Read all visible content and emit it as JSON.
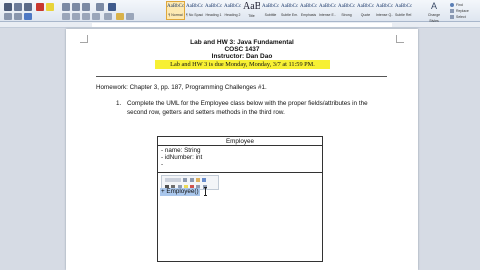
{
  "ribbon": {
    "styles": [
      {
        "sample": "AaBbCcDc",
        "name": "¶ Normal",
        "selected": true
      },
      {
        "sample": "AaBbCcDc",
        "name": "¶ No Spaci...",
        "selected": false
      },
      {
        "sample": "AaBbCc",
        "name": "Heading 1",
        "selected": false
      },
      {
        "sample": "AaBbCc",
        "name": "Heading 2",
        "selected": false
      },
      {
        "sample": "AaB",
        "name": "Title",
        "selected": false
      },
      {
        "sample": "AaBbCc.",
        "name": "Subtitle",
        "selected": false
      },
      {
        "sample": "AaBbCcDc",
        "name": "Subtle Em...",
        "selected": false
      },
      {
        "sample": "AaBbCcDc",
        "name": "Emphasis",
        "selected": false
      },
      {
        "sample": "AaBbCcDc",
        "name": "Intense E...",
        "selected": false
      },
      {
        "sample": "AaBbCcDc",
        "name": "Strong",
        "selected": false
      },
      {
        "sample": "AaBbCcDc",
        "name": "Quote",
        "selected": false
      },
      {
        "sample": "AaBbCcDc",
        "name": "Intense Q...",
        "selected": false
      },
      {
        "sample": "AaBbCcDc",
        "name": "Subtle Ref...",
        "selected": false
      }
    ],
    "change_styles": "Change Styles",
    "editing": [
      "Find",
      "Replace",
      "Select"
    ]
  },
  "document": {
    "title_lines": [
      "Lab and HW 3: Java Fundamental",
      "COSC 1437",
      "Instructor: Dan Dao"
    ],
    "due_line": "Lab and HW 3 is due Monday, Monday, 3/7 at 11:59 PM.",
    "homework_line": "Homework: Chapter 3, pp. 187, Programming Challenges #1.",
    "item_number": "1.",
    "item_text": "Complete the UML for the Employee class below with the proper fields/attributes in the second row, getters and setters methods in the third row.",
    "uml": {
      "class_name": "Employee",
      "fields": [
        "- name: String",
        "- idNumber: int",
        "-"
      ],
      "methods_marker": "-",
      "selected_method": "+ Employee()"
    }
  },
  "colors": {
    "highlight": "#f7f034",
    "selection": "#aac7ec",
    "ribbon_selected": "#fde9b2"
  }
}
